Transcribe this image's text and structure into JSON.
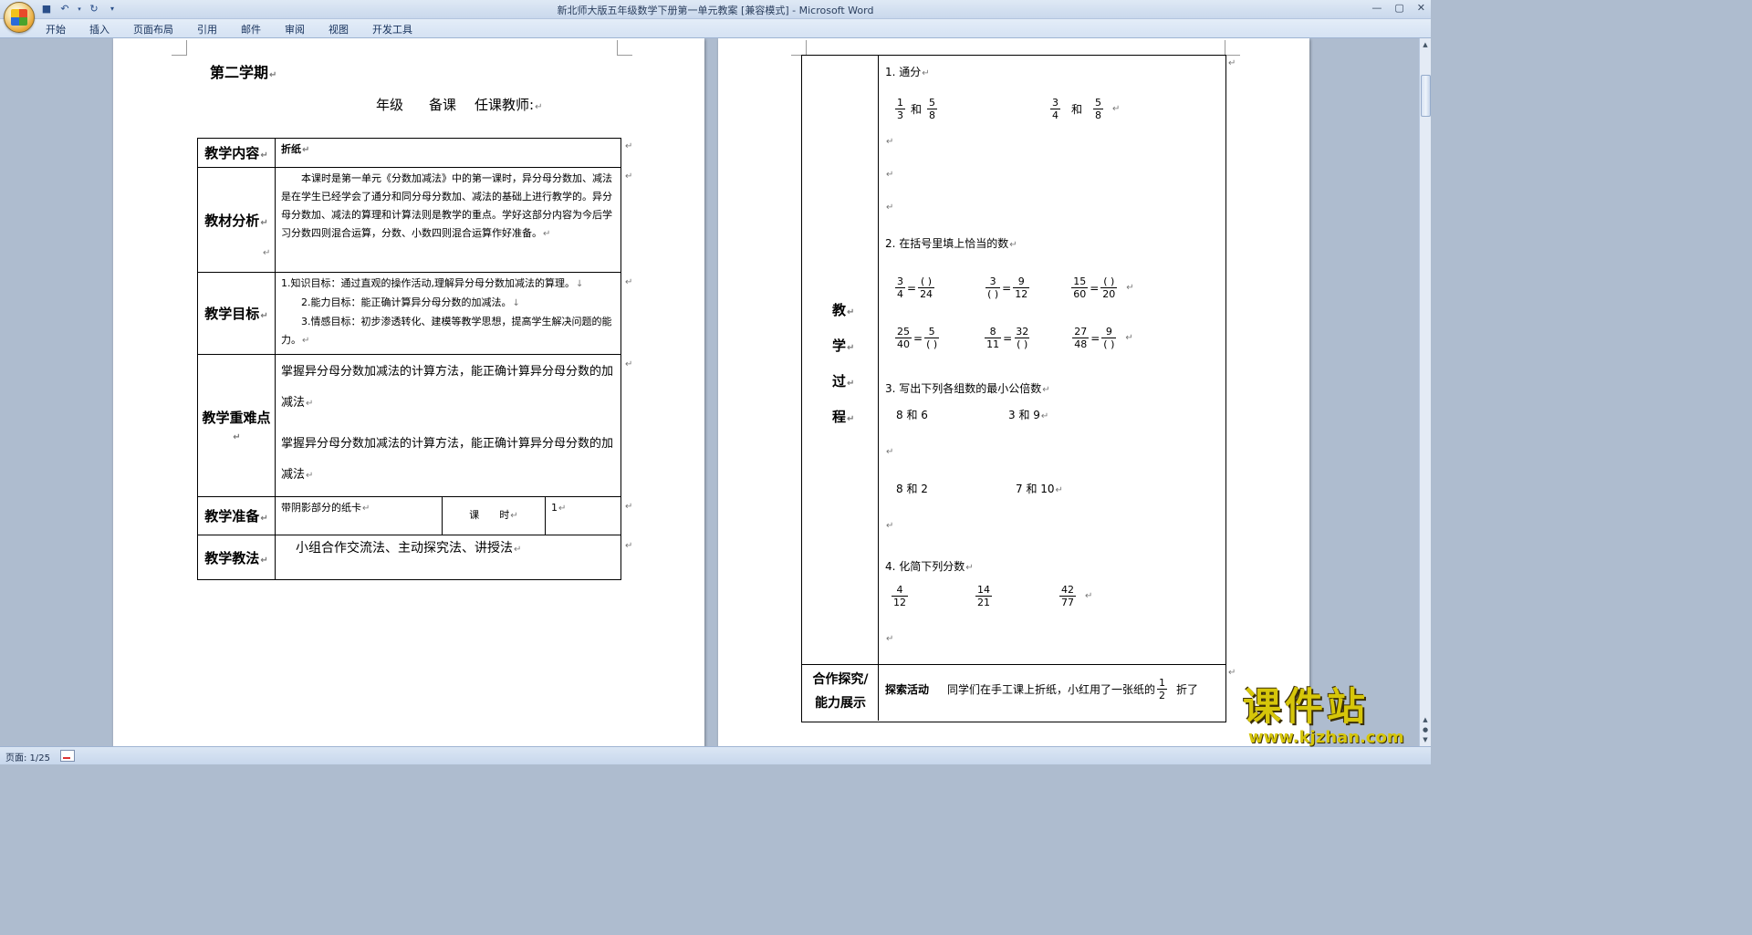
{
  "window": {
    "title": "新北师大版五年级数学下册第一单元教案 [兼容模式] - Microsoft Word",
    "qat_icons": [
      "save-icon",
      "undo-icon",
      "redo-icon",
      "customize-icon"
    ],
    "controls": [
      "—",
      "▢",
      "✕"
    ]
  },
  "ribbon": {
    "tabs": [
      "开始",
      "插入",
      "页面布局",
      "引用",
      "邮件",
      "审阅",
      "视图",
      "开发工具"
    ]
  },
  "status": {
    "page": "页面: 1/25"
  },
  "watermark": {
    "text": "课件站",
    "url": "www.kjzhan.com"
  },
  "page1": {
    "semester": "第二学期",
    "header_line": {
      "grade": "年级",
      "prep": "备课",
      "teacher": "任课教师:"
    },
    "rows": {
      "content": {
        "label": "教学内容",
        "value": "折纸"
      },
      "analysis": {
        "label": "教材分析",
        "value": "本课时是第一单元《分数加减法》中的第一课时，异分母分数加、减法是在学生已经学会了通分和同分母分数加、减法的基础上进行教学的。异分母分数加、减法的算理和计算法则是教学的重点。学好这部分内容为今后学习分数四则混合运算，分数、小数四则混合运算作好准备。"
      },
      "goals": {
        "label": "教学目标",
        "items": [
          "1.知识目标：通过直观的操作活动,理解异分母分数加减法的算理。",
          "2.能力目标：能正确计算异分母分数的加减法。",
          "3.情感目标：初步渗透转化、建模等教学思想，提高学生解决问题的能力。"
        ]
      },
      "key": {
        "label": "教学重难点",
        "p1": "掌握异分母分数加减法的计算方法，能正确计算异分母分数的加减法",
        "p2": "掌握异分母分数加减法的计算方法，能正确计算异分母分数的加减法"
      },
      "prep": {
        "label": "教学准备",
        "value": "带阴影部分的纸卡",
        "lesson_label": "课　　时",
        "lesson_value": "1"
      },
      "method": {
        "label": "教学教法",
        "value": "小组合作交流法、主动探究法、讲授法"
      }
    }
  },
  "page2": {
    "process_label": [
      "教",
      "学",
      "过",
      "程"
    ],
    "q1": {
      "title": "1. 通分",
      "and": "和"
    },
    "q2": {
      "title": "2. 在括号里填上恰当的数",
      "blank": "(   )"
    },
    "q3": {
      "title": "3.  写出下列各组数的最小公倍数",
      "pairs": [
        "8 和 6",
        "3 和 9",
        "8 和 2",
        "7 和 10"
      ]
    },
    "q4": {
      "title": "4.  化简下列分数"
    },
    "coop": {
      "label1": "合作探究/",
      "label2": "能力展示",
      "activity": "探索活动",
      "text": "同学们在手工课上折纸，小红用了一张纸的",
      "frac_n": "1",
      "frac_d": "2",
      "tail": "折了"
    }
  }
}
